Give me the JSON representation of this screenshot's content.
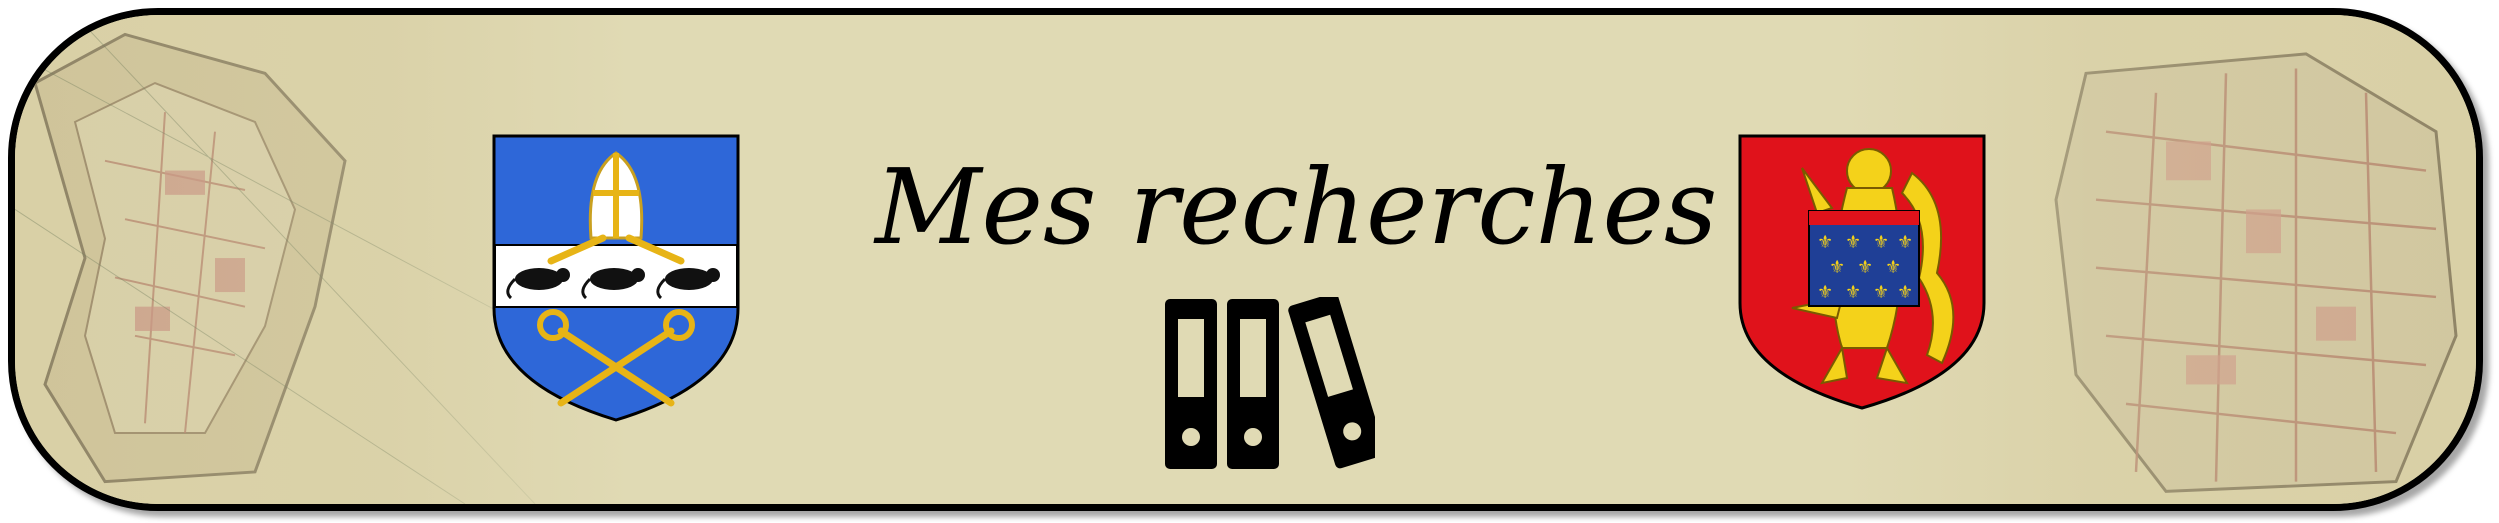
{
  "banner": {
    "title": "Mes recherches",
    "background_color": "#e0dab4",
    "border_color": "#000000"
  },
  "decorations": {
    "left_shield": {
      "icon": "coat-of-arms-blue-mitre-rats-crossed-crosiers-icon",
      "field_color": "#2e67d8",
      "band_color": "#ffffff",
      "charge_color": "#e7b416"
    },
    "right_shield": {
      "icon": "coat-of-arms-red-lion-fleur-de-lis-icon",
      "field_color": "#e0121b",
      "lion_color": "#f4d21a",
      "inescutcheon_color": "#1f3f96"
    },
    "center_icon": "archive-binders-icon",
    "background_map": "old-city-plan-map"
  }
}
